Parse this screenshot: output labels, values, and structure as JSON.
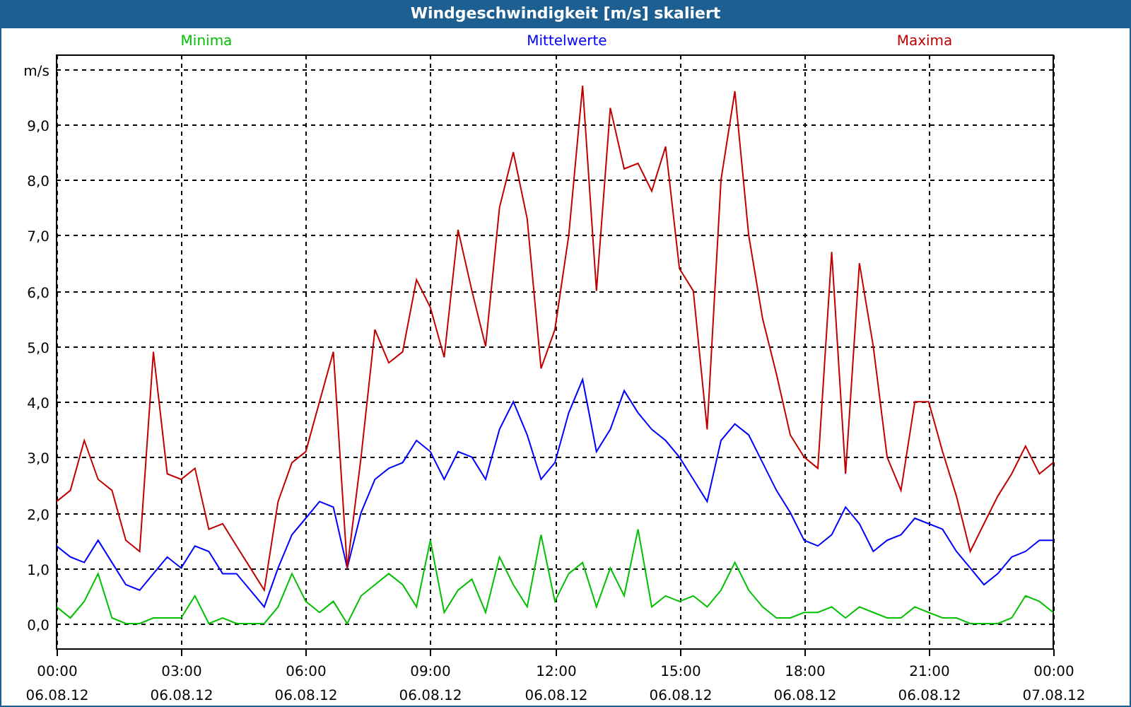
{
  "chart": {
    "chart_data": {
      "type": "line",
      "title": "Windgeschwindigkeit [m/s] skaliert",
      "grid": true,
      "ylim": [
        -0.46,
        10.25
      ],
      "categories": [
        "00:00\n06.08.12",
        null,
        null,
        null,
        null,
        null,
        null,
        null,
        null,
        "03:00\n06.08.12",
        null,
        null,
        null,
        null,
        null,
        null,
        null,
        null,
        "06:00\n06.08.12",
        null,
        null,
        null,
        null,
        null,
        null,
        null,
        null,
        "09:00\n06.08.12",
        null,
        null,
        null,
        null,
        null,
        null,
        null,
        null,
        "12:00\n06.08.12",
        null,
        null,
        null,
        null,
        null,
        null,
        null,
        null,
        "15:00\n06.08.12",
        null,
        null,
        null,
        null,
        null,
        null,
        null,
        null,
        "18:00\n06.08.12",
        null,
        null,
        null,
        null,
        null,
        null,
        null,
        null,
        "21:00\n06.08.12",
        null,
        null,
        null,
        null,
        null,
        null,
        null,
        null,
        "00:00\n07.08.12"
      ],
      "yticks": [
        {
          "value": 0,
          "label": "0,0"
        },
        {
          "value": 1,
          "label": "1,0"
        },
        {
          "value": 2,
          "label": "2,0"
        },
        {
          "value": 3,
          "label": "3,0"
        },
        {
          "value": 4,
          "label": "4,0"
        },
        {
          "value": 5,
          "label": "5,0"
        },
        {
          "value": 6,
          "label": "6,0"
        },
        {
          "value": 7,
          "label": "7,0"
        },
        {
          "value": 8,
          "label": "8,0"
        },
        {
          "value": 9,
          "label": "9,0"
        },
        {
          "value": 10,
          "label": "m/s"
        }
      ],
      "series": [
        {
          "name": "Minima",
          "color": "#00c000",
          "values": [
            0.3,
            0.1,
            0.4,
            0.9,
            0.1,
            0,
            0,
            0.1,
            0.1,
            0.1,
            0.5,
            0,
            0.1,
            0,
            0,
            0,
            0.3,
            0.9,
            0.4,
            0.2,
            0.4,
            0,
            0.5,
            0.7,
            0.9,
            0.7,
            0.3,
            1.5,
            0.2,
            0.6,
            0.8,
            0.2,
            1.2,
            0.7,
            0.3,
            1.6,
            0.4,
            0.9,
            1.1,
            0.3,
            1.0,
            0.5,
            1.7,
            0.3,
            0.5,
            0.4,
            0.5,
            0.3,
            0.6,
            1.1,
            0.6,
            0.3,
            0.1,
            0.1,
            0.2,
            0.2,
            0.3,
            0.1,
            0.3,
            0.2,
            0.1,
            0.1,
            0.3,
            0.2,
            0.1,
            0.1,
            0,
            0,
            0,
            0.1,
            0.5,
            0.4,
            0.2
          ]
        },
        {
          "name": "Mittelwerte",
          "color": "#0000ff",
          "values": [
            1.4,
            1.2,
            1.1,
            1.5,
            1.1,
            0.7,
            0.6,
            0.9,
            1.2,
            1.0,
            1.4,
            1.3,
            0.9,
            0.9,
            0.6,
            0.3,
            1.0,
            1.6,
            1.9,
            2.2,
            2.1,
            1.0,
            2.0,
            2.6,
            2.8,
            2.9,
            3.3,
            3.1,
            2.6,
            3.1,
            3.0,
            2.6,
            3.5,
            4.0,
            3.4,
            2.6,
            2.9,
            3.8,
            4.4,
            3.1,
            3.5,
            4.2,
            3.8,
            3.5,
            3.3,
            3.0,
            2.6,
            2.2,
            3.3,
            3.6,
            3.4,
            2.9,
            2.4,
            2.0,
            1.5,
            1.4,
            1.6,
            2.1,
            1.8,
            1.3,
            1.5,
            1.6,
            1.9,
            1.8,
            1.7,
            1.3,
            1.0,
            0.7,
            0.9,
            1.2,
            1.3,
            1.5,
            1.5
          ]
        },
        {
          "name": "Maxima",
          "color": "#c00000",
          "values": [
            2.2,
            2.4,
            3.3,
            2.6,
            2.4,
            1.5,
            1.3,
            4.9,
            2.7,
            2.6,
            2.8,
            1.7,
            1.8,
            1.4,
            1.0,
            0.6,
            2.2,
            2.9,
            3.1,
            4.0,
            4.9,
            1.0,
            3.0,
            5.3,
            4.7,
            4.9,
            6.2,
            5.7,
            4.8,
            7.1,
            6.0,
            5.0,
            7.5,
            8.5,
            7.3,
            4.6,
            5.3,
            7.0,
            9.7,
            6.0,
            9.3,
            8.2,
            8.3,
            7.8,
            8.6,
            6.4,
            6.0,
            3.5,
            8.0,
            9.6,
            7.0,
            5.5,
            4.5,
            3.4,
            3.0,
            2.8,
            6.7,
            2.7,
            6.5,
            5.0,
            3.0,
            2.4,
            4.0,
            4.0,
            3.1,
            2.3,
            1.3,
            1.8,
            2.3,
            2.7,
            3.2,
            2.7,
            2.9
          ]
        }
      ]
    }
  }
}
